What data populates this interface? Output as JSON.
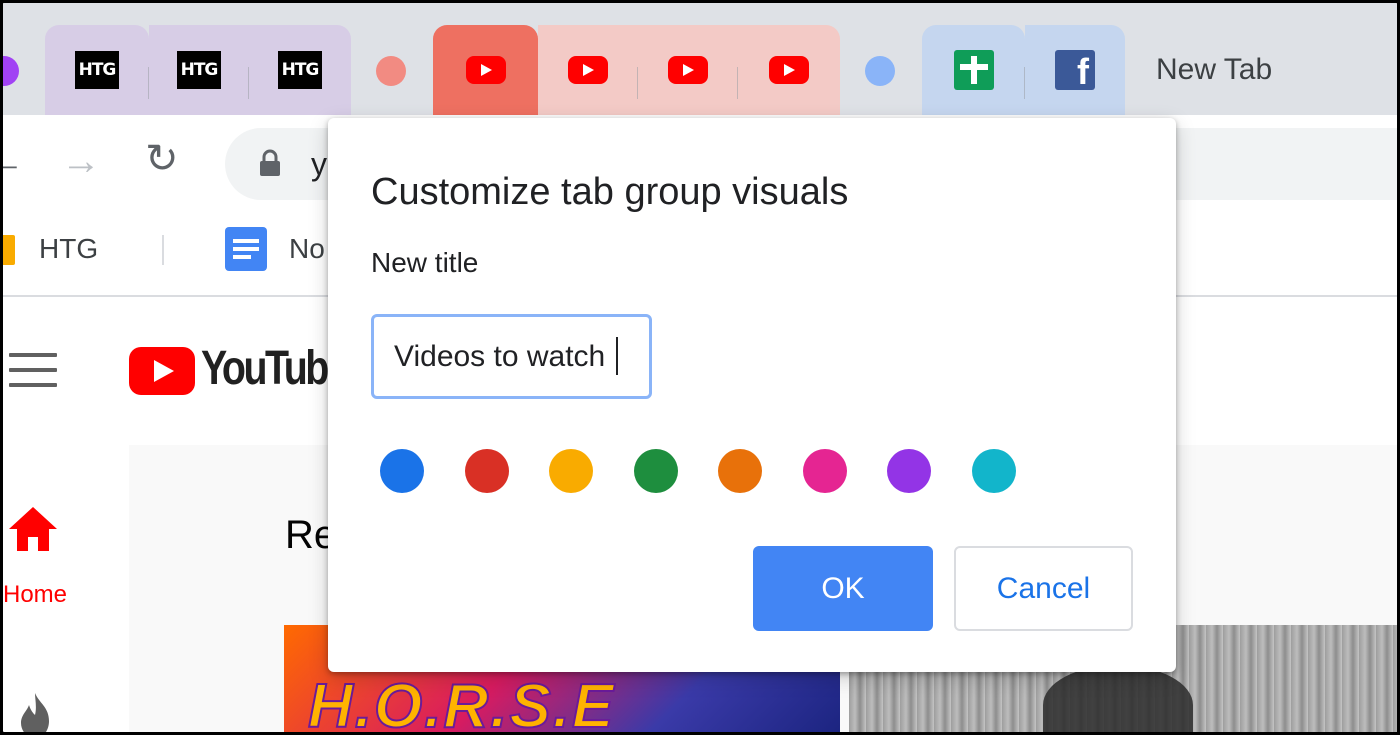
{
  "tabs": {
    "group_colors": {
      "purple": "#a142f4",
      "htg_group": "#d7cde6",
      "red": "#f28b82",
      "youtube_group": "#f3cac6",
      "youtube_active": "#ee7061",
      "blue": "#8ab4f8",
      "blue_group": "#c5d6ef"
    },
    "htg_tabs": [
      {
        "icon": "htg-icon",
        "label": "HTG"
      },
      {
        "icon": "htg-icon",
        "label": "HTG"
      },
      {
        "icon": "htg-icon",
        "label": "HTG"
      }
    ],
    "youtube_tabs": [
      {
        "icon": "youtube-icon",
        "active": true
      },
      {
        "icon": "youtube-icon"
      },
      {
        "icon": "youtube-icon"
      },
      {
        "icon": "youtube-icon"
      }
    ],
    "blue_group_tabs": [
      {
        "icon": "google-sheets-icon"
      },
      {
        "icon": "facebook-icon",
        "label": "f"
      }
    ],
    "new_tab_label": "New Tab"
  },
  "toolbar": {
    "back_icon": "back-arrow-icon",
    "forward_icon": "forward-arrow-icon",
    "reload_icon": "reload-icon",
    "lock_icon": "lock-icon",
    "url_visible": "y"
  },
  "bookmarks": {
    "items": [
      {
        "icon": "folder-icon",
        "label": "HTG"
      },
      {
        "icon": "google-docs-icon",
        "label": "No"
      }
    ]
  },
  "youtube": {
    "wordmark": "YouTube",
    "sidebar": {
      "home_label": "Home"
    },
    "section_heading": "Re",
    "thumbnail_text": "H.O.R.S.E"
  },
  "dialog": {
    "title": "Customize tab group visuals",
    "field_label": "New title",
    "input_value": "Videos to watch",
    "colors": [
      {
        "name": "blue",
        "hex": "#1a73e8"
      },
      {
        "name": "red",
        "hex": "#d93025"
      },
      {
        "name": "yellow",
        "hex": "#f9ab00"
      },
      {
        "name": "green",
        "hex": "#1e8e3e"
      },
      {
        "name": "orange",
        "hex": "#e8710a"
      },
      {
        "name": "pink",
        "hex": "#e52592"
      },
      {
        "name": "purple",
        "hex": "#9334e6"
      },
      {
        "name": "cyan",
        "hex": "#12b5cb"
      }
    ],
    "ok_label": "OK",
    "cancel_label": "Cancel"
  }
}
